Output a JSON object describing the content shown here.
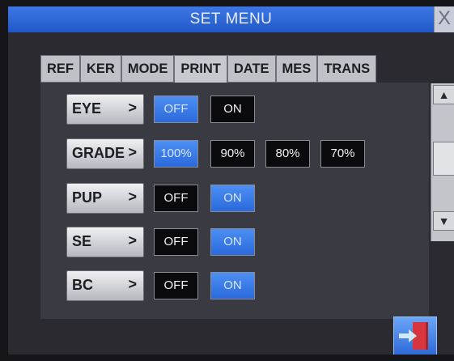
{
  "window": {
    "title": "SET MENU",
    "close_glyph": "X"
  },
  "tabs": [
    {
      "label": "REF",
      "active": false
    },
    {
      "label": "KER",
      "active": false
    },
    {
      "label": "MODE",
      "active": false
    },
    {
      "label": "PRINT",
      "active": true
    },
    {
      "label": "DATE",
      "active": false
    },
    {
      "label": "MES",
      "active": false
    },
    {
      "label": "TRANS",
      "active": false
    }
  ],
  "settings": [
    {
      "label": "EYE",
      "chevron": ">",
      "options": [
        {
          "label": "OFF",
          "selected": true
        },
        {
          "label": "ON",
          "selected": false
        }
      ]
    },
    {
      "label": "GRADE",
      "chevron": ">",
      "options": [
        {
          "label": "100%",
          "selected": true
        },
        {
          "label": "90%",
          "selected": false
        },
        {
          "label": "80%",
          "selected": false
        },
        {
          "label": "70%",
          "selected": false
        }
      ]
    },
    {
      "label": "PUP",
      "chevron": ">",
      "options": [
        {
          "label": "OFF",
          "selected": false
        },
        {
          "label": "ON",
          "selected": true
        }
      ]
    },
    {
      "label": "SE",
      "chevron": ">",
      "options": [
        {
          "label": "OFF",
          "selected": false
        },
        {
          "label": "ON",
          "selected": true
        }
      ]
    },
    {
      "label": "BC",
      "chevron": ">",
      "options": [
        {
          "label": "OFF",
          "selected": false
        },
        {
          "label": "ON",
          "selected": true
        }
      ]
    }
  ],
  "scrollbar": {
    "up_glyph": "▲",
    "down_glyph": "▼"
  },
  "footer": {
    "exit_icon": "exit-door-icon"
  }
}
